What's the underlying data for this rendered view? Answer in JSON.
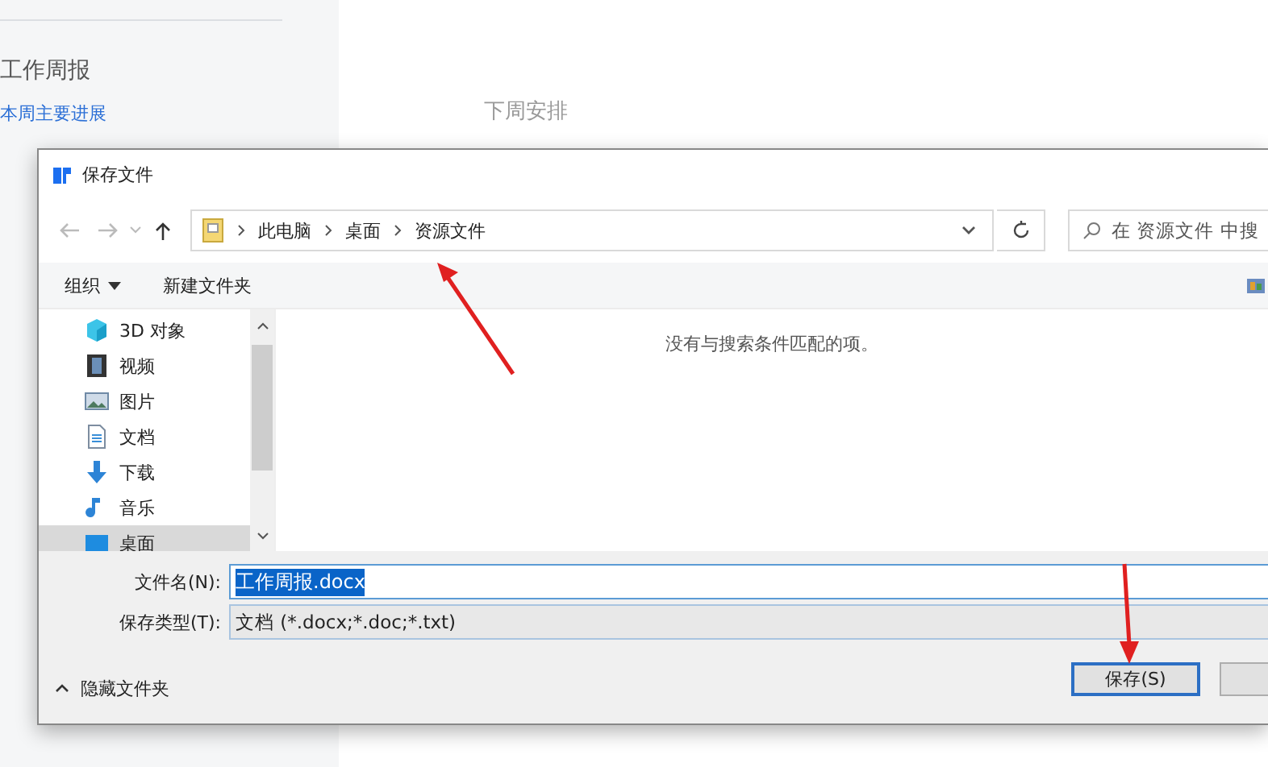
{
  "background": {
    "sidebar": {
      "title": "工作周报",
      "link": "本周主要进展"
    },
    "section_heading": "下周安排"
  },
  "dialog": {
    "title": "保存文件",
    "breadcrumbs": [
      "此电脑",
      "桌面",
      "资源文件"
    ],
    "search": {
      "placeholder": "在 资源文件 中搜"
    },
    "toolbar": {
      "organize": "组织",
      "new_folder": "新建文件夹"
    },
    "nav_items": [
      {
        "label": "3D 对象",
        "kind": "cube",
        "selected": false
      },
      {
        "label": "视频",
        "kind": "video",
        "selected": false
      },
      {
        "label": "图片",
        "kind": "picture",
        "selected": false
      },
      {
        "label": "文档",
        "kind": "document",
        "selected": false
      },
      {
        "label": "下载",
        "kind": "download",
        "selected": false
      },
      {
        "label": "音乐",
        "kind": "music",
        "selected": false
      },
      {
        "label": "桌面",
        "kind": "desktop",
        "selected": true
      }
    ],
    "empty_message": "没有与搜索条件匹配的项。",
    "file_name": {
      "label": "文件名(N):",
      "value": "工作周报.docx"
    },
    "file_type": {
      "label": "保存类型(T):",
      "value": "文档 (*.docx;*.doc;*.txt)"
    },
    "hide_folders": "隐藏文件夹",
    "buttons": [
      {
        "label": "保存(S)",
        "kind": "default"
      },
      {
        "kind": "plain"
      }
    ]
  }
}
